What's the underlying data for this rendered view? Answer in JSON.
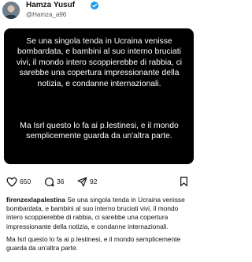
{
  "post": {
    "author_name": "Hamza Yusuf",
    "author_handle": "@Hamza_a96",
    "card_paragraph_1": "Se una singola tenda in Ucraina venisse bombardata, e bambini al suo interno bruciati vivi, il mondo intero scoppierebbe di rabbia, ci sarebbe una copertura impressionante della notizia, e condanne internazionali.",
    "card_paragraph_2": "Ma Isrl questo lo fa ai p.lestinesi, e il mondo semplicemente guarda da un'altra parte."
  },
  "actions": {
    "likes": "650",
    "comments": "36",
    "shares": "92"
  },
  "caption": {
    "username": "firenzexlapalestina",
    "text_1": "Se una singola tenda in Ucraina venisse bombardata, e bambini al suo interno bruciati vivi, il mondo intero scoppierebbe di rabbia, ci sarebbe una copertura impressionante della notizia, e condanne internazionali.",
    "text_2": "Ma Isrl questo lo fa ai p.lestinesi, e il mondo semplicemente guarda da un'altra parte."
  },
  "icons": {
    "verified": "verified-badge-icon",
    "like": "heart-icon",
    "comment": "comment-bubble-icon",
    "share": "paper-plane-icon",
    "bookmark": "bookmark-icon"
  },
  "colors": {
    "verified_blue": "#1d9bf0",
    "card_background": "#000000"
  }
}
